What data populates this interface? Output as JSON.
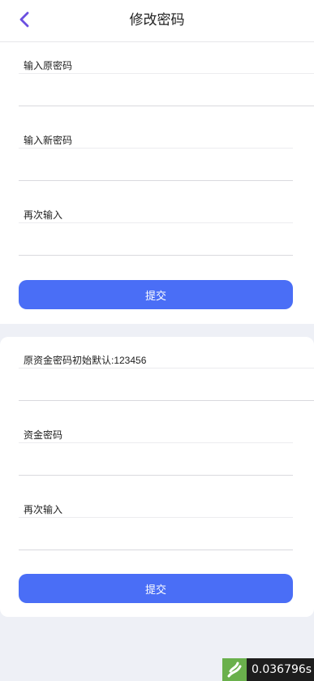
{
  "header": {
    "title": "修改密码",
    "back_icon": "chevron-left-icon",
    "accent_color": "#6b4fe0"
  },
  "login_password": {
    "fields": [
      {
        "label": "输入原密码",
        "value": "",
        "placeholder": ""
      },
      {
        "label": "输入新密码",
        "value": "",
        "placeholder": ""
      },
      {
        "label": "再次输入",
        "value": "",
        "placeholder": ""
      }
    ],
    "submit_label": "提交"
  },
  "fund_password": {
    "fields": [
      {
        "label": "原资金密码初始默认:123456",
        "value": "",
        "placeholder": ""
      },
      {
        "label": "资金密码",
        "value": "",
        "placeholder": ""
      },
      {
        "label": "再次输入",
        "value": "",
        "placeholder": ""
      }
    ],
    "submit_label": "提交"
  },
  "perf_badge": {
    "text": "0.036796s",
    "logo_icon": "flame-logo-icon"
  },
  "colors": {
    "button": "#4a6ef6",
    "background": "#eef0f6"
  }
}
